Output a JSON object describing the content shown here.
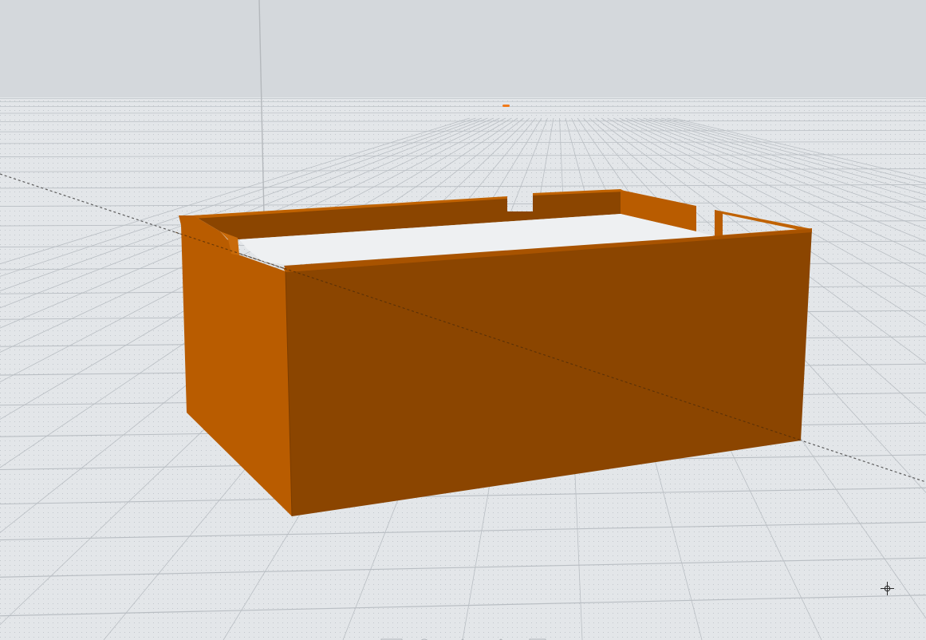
{
  "viewport": {
    "background_color": "#d4d8dc",
    "grid_floor_color": "#e4e7ea",
    "grid_line_color": "#b9bec3",
    "axis_line_color": "#5c5c5c",
    "vertical_axis_color": "#b4b8bc"
  },
  "model": {
    "name": "box",
    "front_face_color": "#8b4500",
    "side_face_color": "#b95c00",
    "rim_color": "#c06200",
    "inner_face_color": "#9a4d00"
  },
  "origin_marker": {
    "color": "#f07a1a"
  },
  "cursor": {
    "icon": "crosshair-cursor-icon"
  }
}
